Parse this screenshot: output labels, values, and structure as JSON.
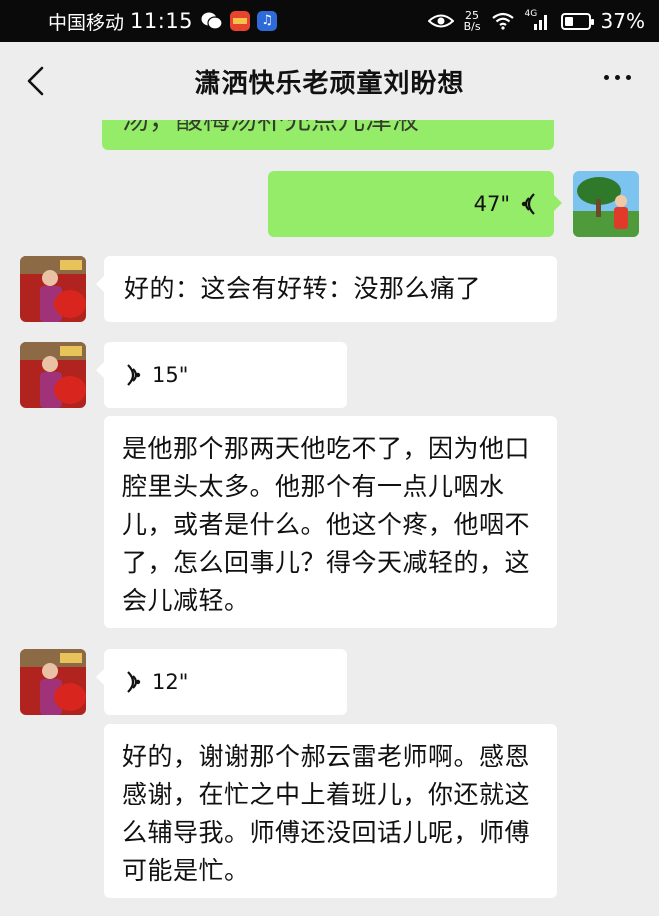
{
  "status_bar": {
    "carrier": "中国移动",
    "time": "11:15",
    "net_speed_top": "25",
    "net_speed_bottom": "B/s",
    "signal_label": "4G",
    "battery_percent": "37%",
    "battery_level": 0.37
  },
  "nav": {
    "title": "潇洒快乐老顽童刘盼想"
  },
  "messages": {
    "partial_top_text": "汤，酸梅汤补充点儿津液",
    "voice_outgoing_duration": "47\"",
    "text_incoming_1": "好的：这会有好转：没那么痛了",
    "voice_incoming_1_duration": "15\"",
    "transcript_1": "是他那个那两天他吃不了，因为他口腔里头太多。他那个有一点儿咽水儿，或者是什么。他这个疼，他咽不了，怎么回事儿？得今天减轻的，这会儿减轻。",
    "voice_incoming_2_duration": "12\"",
    "transcript_2": "好的，谢谢那个郝云雷老师啊。感恩感谢，在忙之中上着班儿，你还就这么辅导我。师傅还没回话儿呢，师傅可能是忙。"
  },
  "colors": {
    "bubble_green": "#95ec69",
    "bubble_white": "#ffffff",
    "chat_background": "#ededed",
    "status_bar": "#0a0a0a"
  }
}
